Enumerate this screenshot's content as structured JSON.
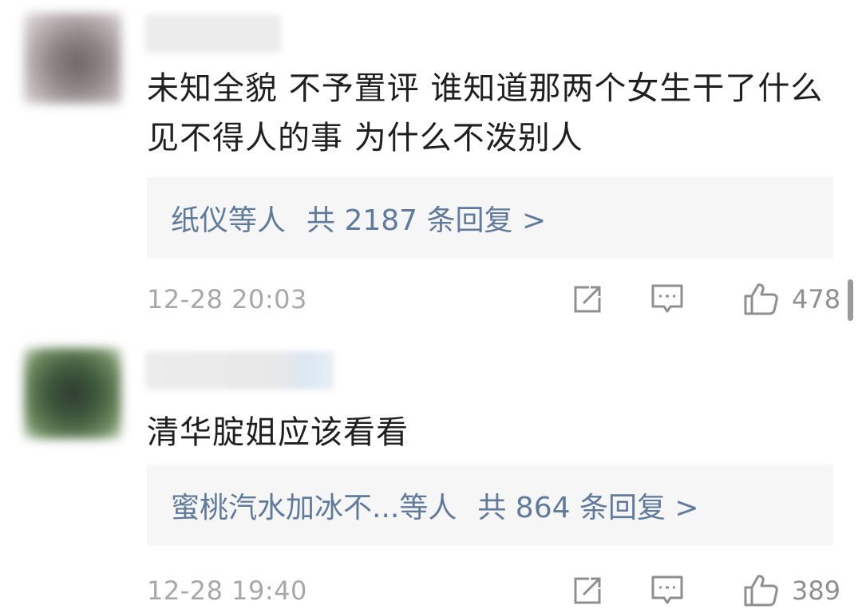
{
  "comments": [
    {
      "text": "未知全貌 不予置评  谁知道那两个女生干了什么见不得人的事 为什么不泼别人",
      "replies": {
        "names": "纸仪等人",
        "count_text": "共 2187 条回复 >"
      },
      "timestamp": "12-28 20:03",
      "likes": "478"
    },
    {
      "text": "清华腚姐应该看看",
      "replies": {
        "names": "蜜桃汽水加冰不...等人",
        "count_text": "共 864 条回复 >"
      },
      "timestamp": "12-28 19:40",
      "likes": "389"
    }
  ],
  "colors": {
    "reply_link": "#5f7a9b",
    "meta_gray": "#a8a8a8",
    "icon_gray": "#8f8f8f",
    "reply_box_bg": "#f6f6f6"
  },
  "icons": [
    "repost-icon",
    "comment-icon",
    "like-icon"
  ]
}
